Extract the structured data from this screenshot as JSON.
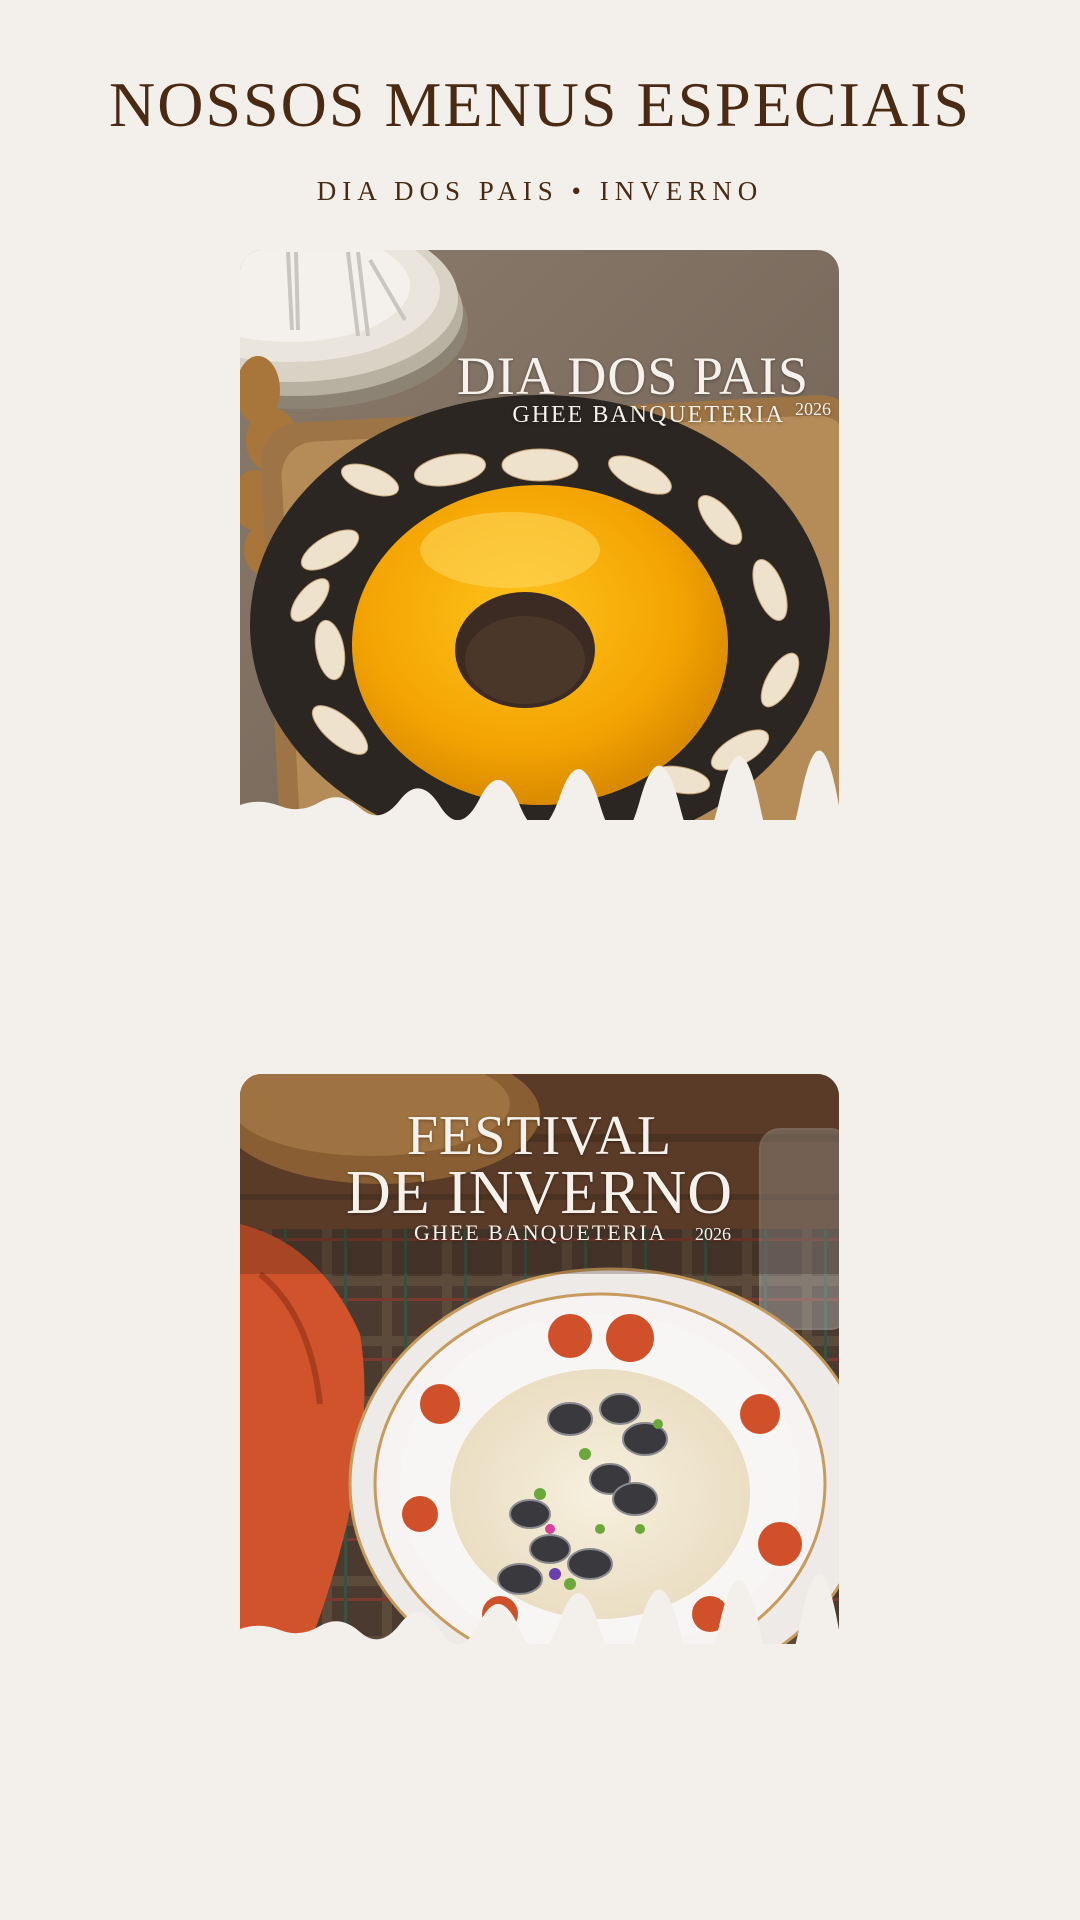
{
  "header": {
    "title": "NOSSOS MENUS ESPECIAIS",
    "subtitle": "DIA DOS PAIS • INVERNO"
  },
  "menus": [
    {
      "title": "DIA DOS PAIS",
      "brand": "GHEE BANQUETERIA",
      "year": "2026"
    },
    {
      "title_line1": "FESTIVAL",
      "title_line2": "DE INVERNO",
      "brand": "GHEE BANQUETERIA",
      "year": "2026"
    }
  ],
  "colors": {
    "background": "#f3f0ec",
    "heading": "#4a2a12",
    "card_text": "#f6f1ea"
  }
}
